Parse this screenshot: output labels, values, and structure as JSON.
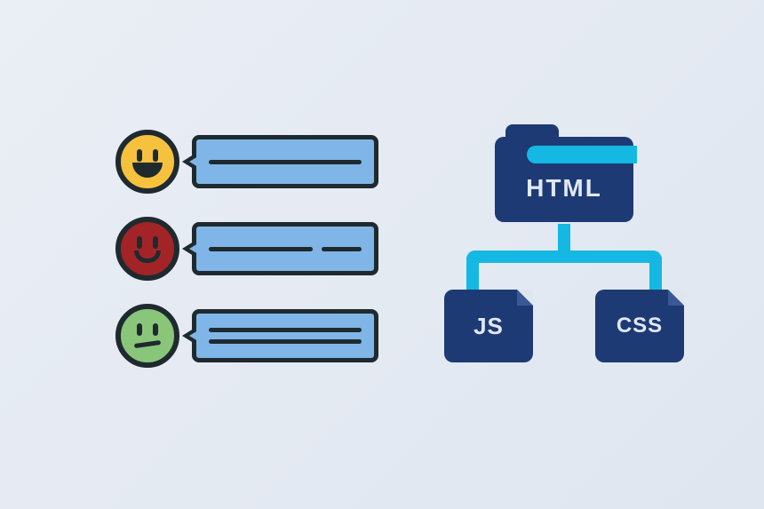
{
  "feedback": {
    "rows": [
      {
        "mood": "happy",
        "color": "yellow"
      },
      {
        "mood": "smile",
        "color": "red"
      },
      {
        "mood": "meh",
        "color": "green"
      }
    ]
  },
  "tech": {
    "root_label": "HTML",
    "children": [
      {
        "label": "JS"
      },
      {
        "label": "CSS"
      }
    ]
  },
  "colors": {
    "stroke": "#1f2a2f",
    "bubble_fill": "#7fb6e7",
    "navy": "#1d3a74",
    "cyan": "#15b8e2",
    "face_yellow": "#f6c23d",
    "face_red": "#a32427",
    "face_green": "#89c67a"
  }
}
